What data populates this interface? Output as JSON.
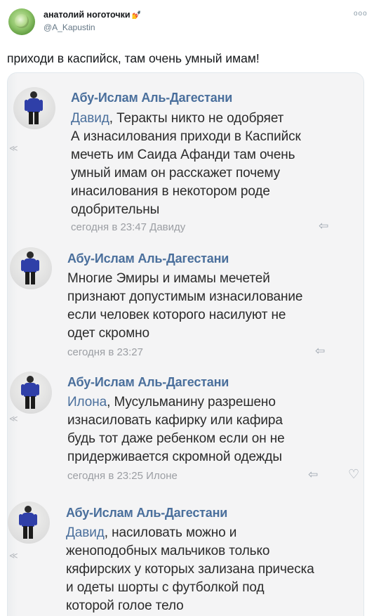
{
  "tweet": {
    "display_name": "анатолий ноготочки",
    "name_emoji": "💅",
    "handle": "@A_Kapustin",
    "more_icon": "more-icon",
    "text": "приходи в каспийск, там очень умный имам!"
  },
  "screenshot": {
    "edge_marks": [
      "≪",
      "≪",
      "≪"
    ],
    "comments": [
      {
        "author": "Абу-Ислам Аль-Дагестани",
        "addressee": "Давид",
        "lines": [
          ", Теракты никто не одобряет",
          "А изнасилования приходи в Каспийск",
          "мечеть им Саида Афанди там очень",
          "умный имам он расскажет почему",
          "инасилования в некотором роде",
          "одобрительны"
        ],
        "meta": "сегодня в 23:47 Давиду",
        "reply_icon": "reply-icon"
      },
      {
        "author": "Абу-Ислам Аль-Дагестани",
        "addressee": "",
        "lines": [
          "Многие Эмиры и имамы мечетей",
          "признают допустимым изнасилование",
          "если человек которого насилуют не",
          "одет скромно"
        ],
        "meta": "сегодня в 23:27",
        "reply_icon": "reply-icon"
      },
      {
        "author": "Абу-Ислам Аль-Дагестани",
        "addressee": "Илона",
        "lines": [
          ", Мусульманину разрешено",
          "изнасиловать кафирку или кафира",
          "будь тот даже ребенком если он не",
          "придерживается скромной одежды"
        ],
        "meta": "сегодня в 23:25 Илоне",
        "reply_icon": "reply-icon",
        "like_icon": "heart-icon"
      },
      {
        "author": "Абу-Ислам Аль-Дагестани",
        "addressee": "Давид",
        "lines": [
          ", насиловать можно и",
          "женоподобных мальчиков только",
          "кяфирских у которых зализана прическа",
          "и одеты шорты с футболкой под",
          "которой голое тело"
        ]
      }
    ]
  },
  "colors": {
    "link_blue": "#4a6f9c",
    "meta_gray": "#9b9ea3",
    "handle_gray": "#657786"
  }
}
